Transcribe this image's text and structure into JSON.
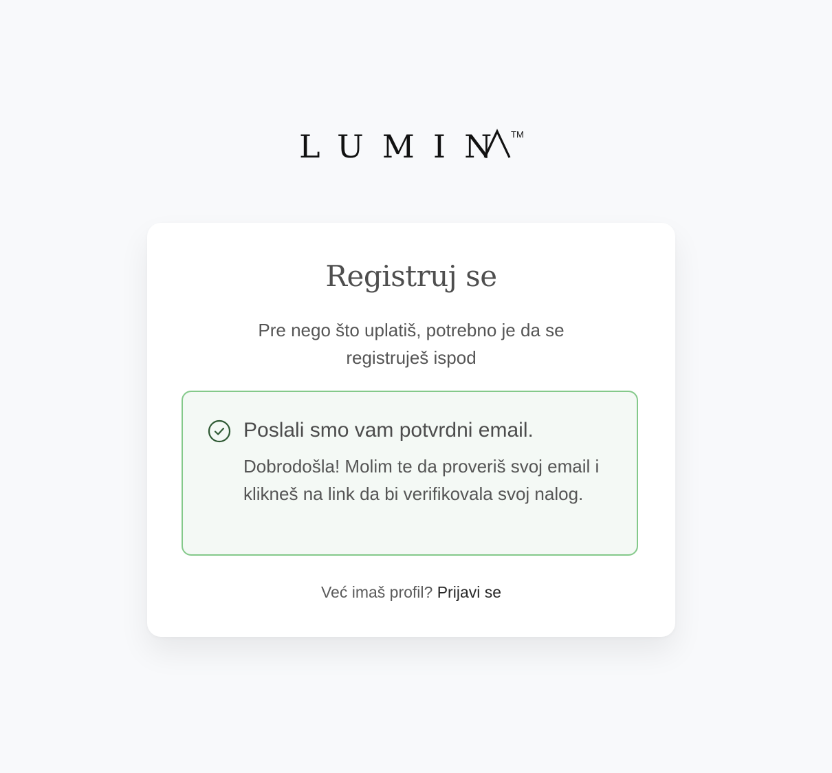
{
  "brand": {
    "name": "LUMINA",
    "trademark": "TM"
  },
  "card": {
    "title": "Registruj se",
    "subtitle": "Pre nego što uplatiš, potrebno je da se registruješ ispod"
  },
  "alert": {
    "icon": "check-circle-icon",
    "title": "Poslali smo vam potvrdni email.",
    "message": "Dobrodošla! Molim te da proveriš svoj email i klikneš na link da bi verifikovala svoj nalog.",
    "border_color": "#84c98a",
    "background_color": "#f4f9f5",
    "icon_color": "#2f5a34"
  },
  "footer": {
    "prompt": "Već imaš profil?",
    "link_label": "Prijavi se"
  }
}
